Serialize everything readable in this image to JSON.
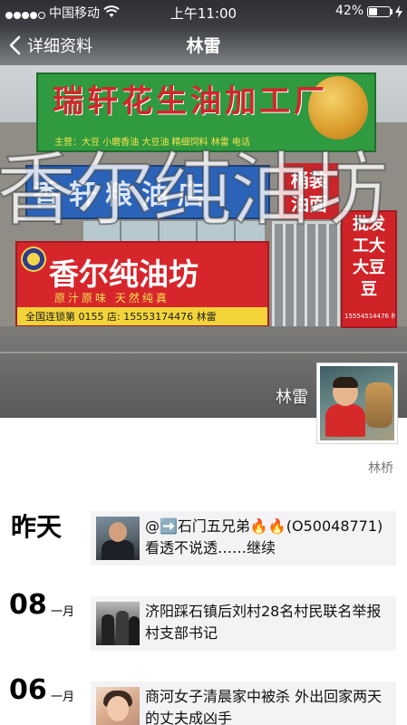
{
  "status_bar": {
    "carrier": "中国移动",
    "time": "上午11:00",
    "battery_percent": "42%",
    "battery_level": 0.42,
    "signal_bars_filled": 4,
    "signal_bars_total": 5
  },
  "nav": {
    "back_label": "详细资料",
    "title": "林雷"
  },
  "cover": {
    "watermark": "香尔纯油坊",
    "green_sign": "瑞轩花生油加工厂",
    "green_sign_sub": "主营：大豆 小磨香油 大豆油 精细饲料  林雷 电话",
    "blue_sign": "香轩粮油店",
    "red_pillar": "桶装 油面",
    "shop_name": "香尔纯油坊",
    "shop_slogan": "原汁原味  天然纯真",
    "shop_contact": "全国连锁第 0155 店: 15553174476 林雷",
    "side_banner": "批发 工大 大豆 豆",
    "side_banner_small": "15554514476 林雷",
    "display_name": "林雷",
    "signature": "林桥"
  },
  "timeline": [
    {
      "date_label": "昨天",
      "text": "@➡️石门五兄弟🔥🔥(O50048771)看透不说透……继续",
      "thumb_icon": "man-portrait-photo"
    },
    {
      "day": "08",
      "month": "一月",
      "text": "济阳踩石镇后刘村28名村民联名举报村支部书记",
      "thumb_icon": "crowd-photo"
    },
    {
      "day": "06",
      "month": "一月",
      "text": "商河女子清晨家中被杀 外出回家两天的丈夫成凶手",
      "thumb_icon": "woman-portrait-photo"
    }
  ]
}
